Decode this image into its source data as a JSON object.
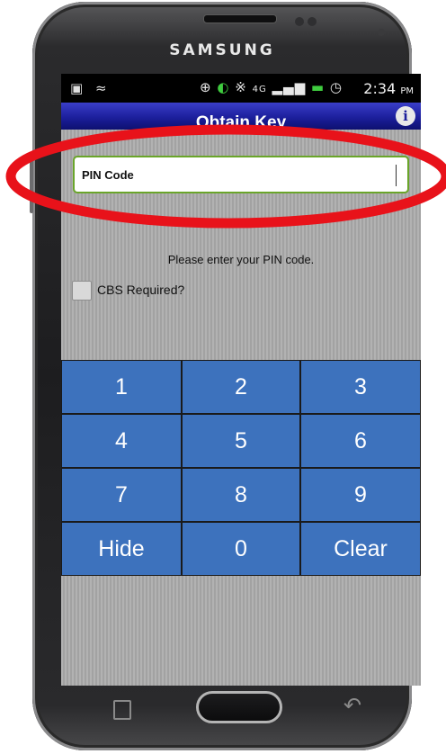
{
  "device": {
    "brand": "SAMSUNG"
  },
  "status_bar": {
    "left_icons": [
      "gallery-icon",
      "wifi-icon"
    ],
    "right_icons": [
      "gps-icon",
      "signal-icon",
      "bluetooth-icon",
      "4g-lte-icon",
      "cell-signal-icon",
      "battery-icon",
      "alarm-icon"
    ],
    "network_label": "4G",
    "time": "2:34",
    "time_suffix": "PM"
  },
  "app": {
    "title": "Obtain Key",
    "info_icon": "i"
  },
  "form": {
    "pin_label": "PIN Code",
    "prompt": "Please enter your PIN code.",
    "checkbox_label": "CBS Required?",
    "checkbox_checked": false
  },
  "keypad": {
    "keys": [
      "1",
      "2",
      "3",
      "4",
      "5",
      "6",
      "7",
      "8",
      "9",
      "Hide",
      "0",
      "Clear"
    ]
  },
  "colors": {
    "title_bar": "#1c1f9c",
    "key_fill": "#3d72bd",
    "field_border": "#6aa52a",
    "annotation": "#e8121a"
  }
}
